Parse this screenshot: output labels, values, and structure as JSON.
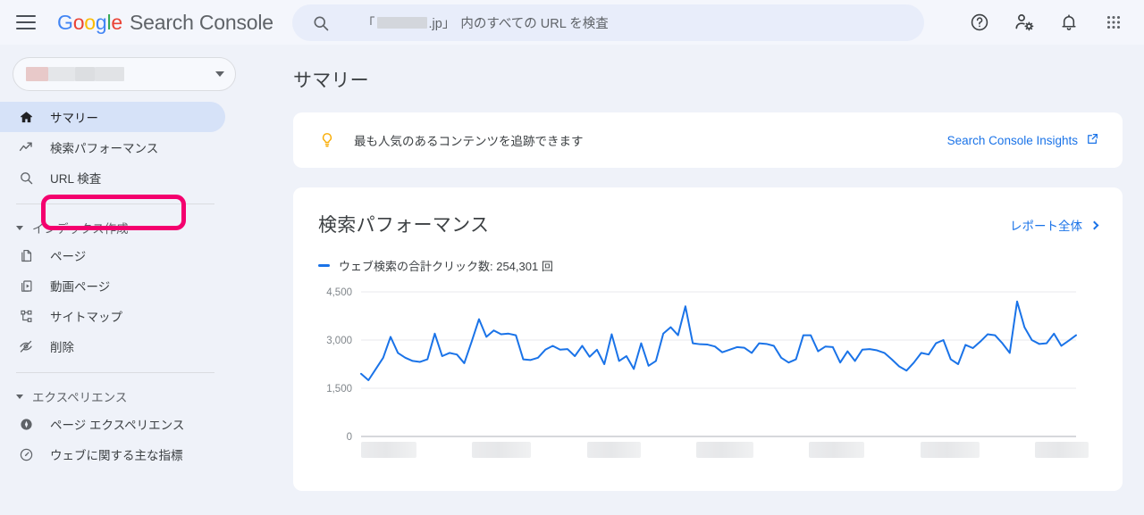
{
  "topbar": {
    "menu_icon": "hamburger-icon",
    "brand_google": "Google",
    "brand_product": "Search Console",
    "search": {
      "icon": "search-icon",
      "prefix": "「",
      "domain_suffix": ".jp」",
      "text": "内のすべての URL を検査"
    },
    "icons": [
      {
        "name": "help-icon",
        "label": "ヘルプ"
      },
      {
        "name": "account-settings-icon",
        "label": "アカウント設定"
      },
      {
        "name": "notifications-bell-icon",
        "label": "通知"
      },
      {
        "name": "apps-grid-icon",
        "label": "Google アプリ"
      }
    ]
  },
  "sidebar": {
    "property_selector": {
      "caret": "chevron-down-icon"
    },
    "items": [
      {
        "label": "サマリー",
        "icon": "home-icon",
        "active": true
      },
      {
        "label": "検索パフォーマンス",
        "icon": "trending-up-icon",
        "active": false,
        "highlighted": true
      },
      {
        "label": "URL 検査",
        "icon": "search-icon",
        "active": false
      }
    ],
    "sections": [
      {
        "title": "インデックス作成",
        "items": [
          {
            "label": "ページ",
            "icon": "pages-icon"
          },
          {
            "label": "動画ページ",
            "icon": "video-page-icon"
          },
          {
            "label": "サイトマップ",
            "icon": "sitemap-icon"
          },
          {
            "label": "削除",
            "icon": "eye-off-icon"
          }
        ]
      },
      {
        "title": "エクスペリエンス",
        "items": [
          {
            "label": "ページ エクスペリエンス",
            "icon": "page-experience-icon"
          },
          {
            "label": "ウェブに関する主な指標",
            "icon": "core-web-vitals-icon"
          }
        ]
      }
    ]
  },
  "main": {
    "page_title": "サマリー",
    "insights": {
      "icon": "lightbulb-icon",
      "text": "最も人気のあるコンテンツを追跡できます",
      "link_label": "Search Console Insights",
      "link_icon": "external-link-icon"
    },
    "performance": {
      "title": "検索パフォーマンス",
      "full_report_label": "レポート全体",
      "full_report_icon": "chevron-right-icon",
      "legend_label": "ウェブ検索の合計クリック数: 254,301 回"
    }
  },
  "colors": {
    "page_background": "#eff2f9",
    "topbar_background": "#f4f6fc",
    "card_background": "#ffffff",
    "accent_blue": "#1a73e8",
    "active_nav_background": "#d6e2f8",
    "annotation_pink": "#f4006e",
    "lightbulb_yellow": "#f9ab00",
    "chart_line": "#1a73e8"
  },
  "chart_data": {
    "type": "line",
    "title": "検索パフォーマンス",
    "series_name": "ウェブ検索の合計クリック数",
    "total_clicks": 254301,
    "total_clicks_label": "254,301 回",
    "ylabel": "",
    "xlabel": "",
    "ylim": [
      0,
      4500
    ],
    "yticks": [
      0,
      1500,
      3000,
      4500
    ],
    "ytick_labels": [
      "0",
      "1,500",
      "3,000",
      "4,500"
    ],
    "grid": true,
    "legend_position": "top-left",
    "x_tick_labels_redacted": true,
    "x_tick_count": 7,
    "values": [
      1950,
      1750,
      2100,
      2450,
      3100,
      2600,
      2450,
      2350,
      2320,
      2400,
      3200,
      2500,
      2600,
      2550,
      2280,
      2950,
      3650,
      3100,
      3300,
      3180,
      3200,
      3150,
      2400,
      2380,
      2450,
      2700,
      2820,
      2700,
      2720,
      2500,
      2820,
      2480,
      2700,
      2250,
      3180,
      2350,
      2500,
      2100,
      2900,
      2200,
      2350,
      3200,
      3400,
      3150,
      4050,
      2900,
      2870,
      2860,
      2800,
      2620,
      2700,
      2780,
      2760,
      2600,
      2900,
      2880,
      2820,
      2450,
      2300,
      2400,
      3150,
      3150,
      2650,
      2800,
      2780,
      2300,
      2650,
      2350,
      2700,
      2720,
      2680,
      2600,
      2400,
      2180,
      2050,
      2300,
      2600,
      2550,
      2900,
      3000,
      2400,
      2250,
      2850,
      2750,
      2950,
      3180,
      3150,
      2900,
      2600,
      4200,
      3400,
      3000,
      2880,
      2900,
      3200,
      2820,
      2980,
      3150
    ]
  }
}
